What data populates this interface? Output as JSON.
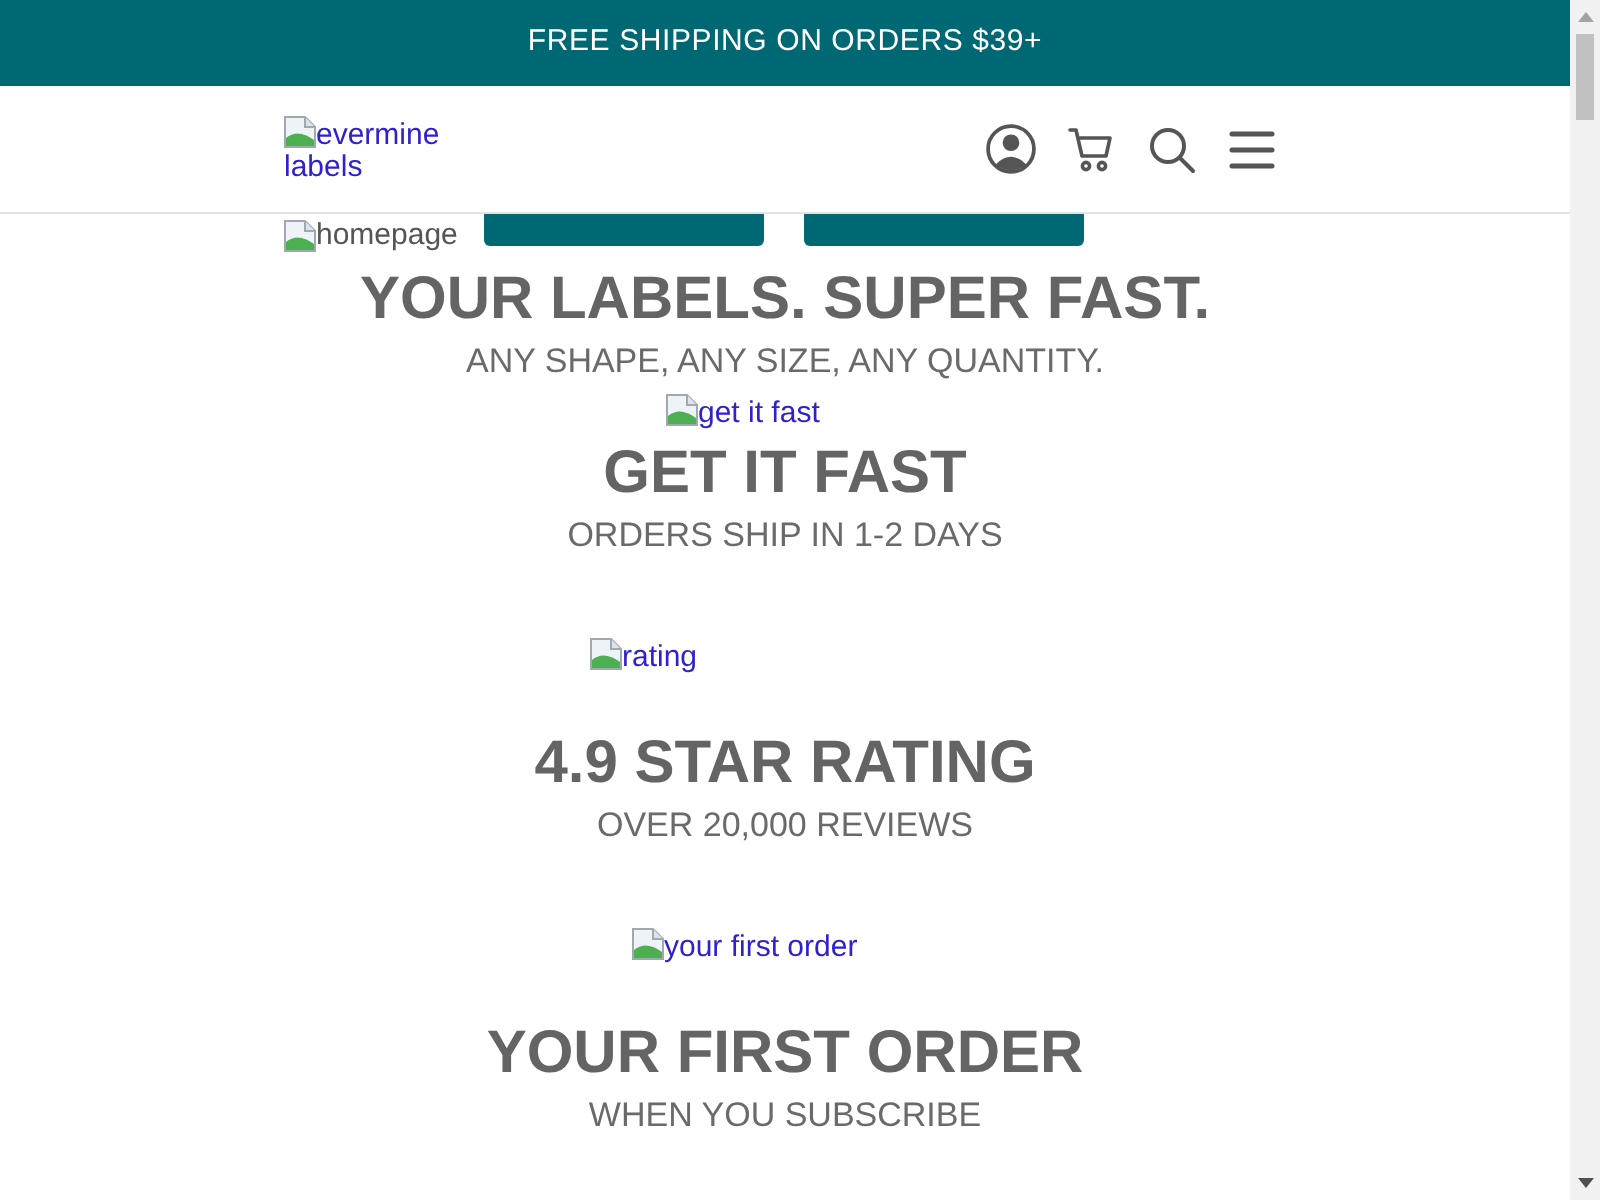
{
  "banner": {
    "text": "FREE SHIPPING ON ORDERS $39+"
  },
  "header": {
    "logo_alt": "evermine labels"
  },
  "hero": {
    "image_alt": "homepage",
    "title": "YOUR LABELS. SUPER FAST.",
    "subtitle": "ANY SHAPE, ANY SIZE, ANY QUANTITY."
  },
  "features": [
    {
      "image_alt": "get it fast",
      "title": "GET IT FAST",
      "subtitle": "ORDERS SHIP IN 1-2 DAYS"
    },
    {
      "image_alt": "rating",
      "title": "4.9 STAR RATING",
      "subtitle": "OVER 20,000 REVIEWS"
    },
    {
      "image_alt": "your first order",
      "title": "YOUR FIRST ORDER",
      "subtitle": "WHEN YOU SUBSCRIBE"
    }
  ]
}
